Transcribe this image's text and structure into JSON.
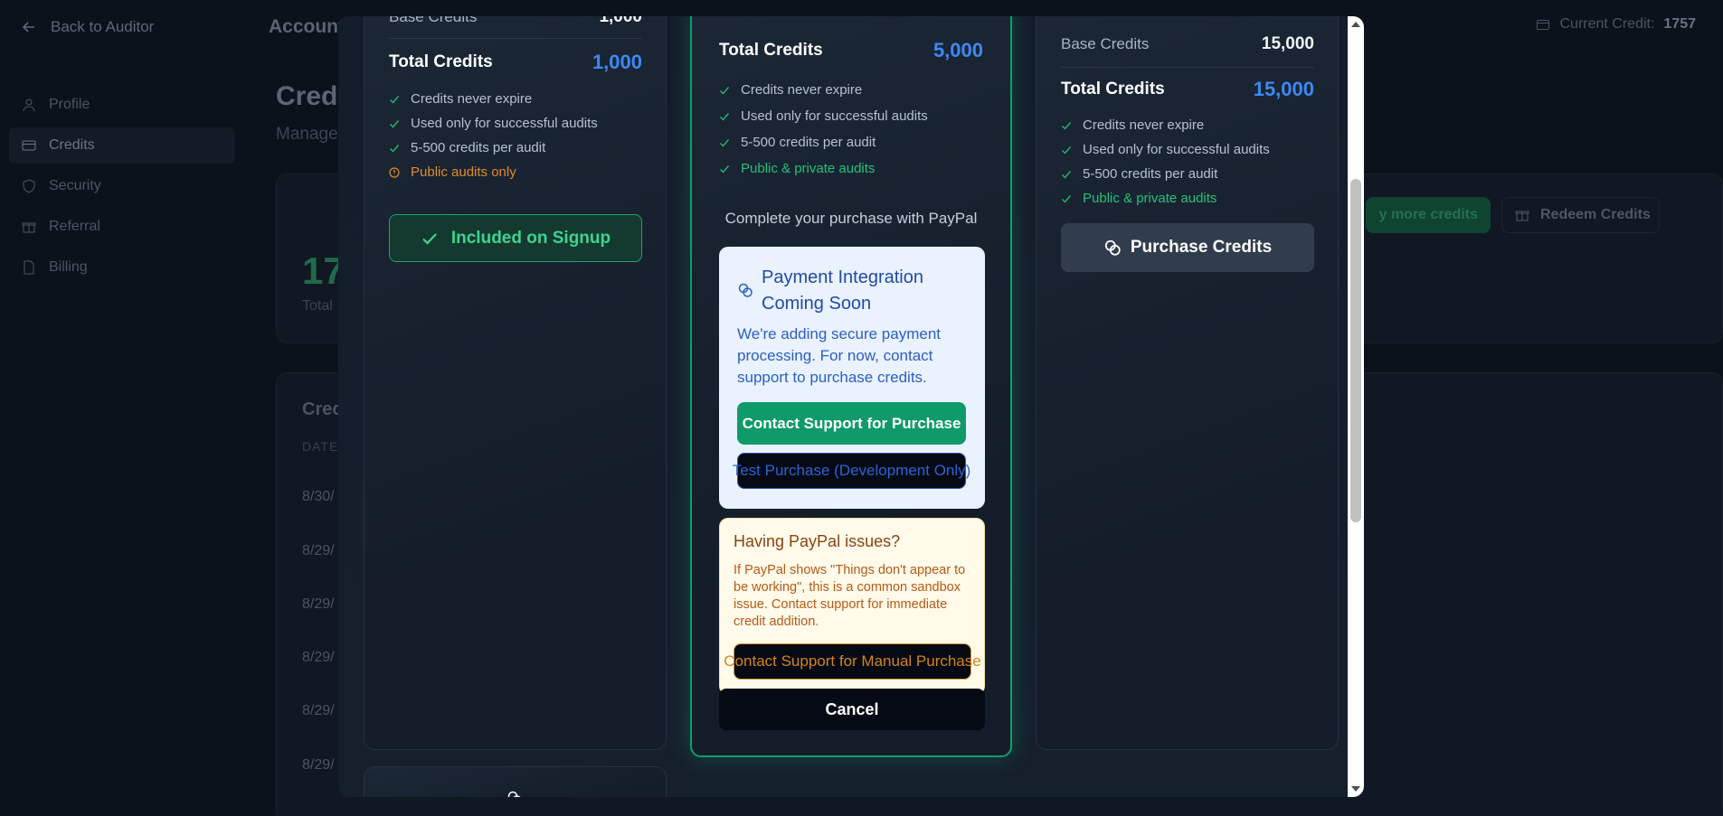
{
  "background": {
    "back_label": "Back to Auditor",
    "heading": "Account",
    "current_credit_label": "Current Credit:",
    "current_credit_value": "1757",
    "nav": [
      "Profile",
      "Credits",
      "Security",
      "Referral",
      "Billing"
    ],
    "main_title": "Credi",
    "main_subtitle": "Manage",
    "big_number": "17",
    "big_caption": "Total",
    "section_title": "Cred",
    "column_header": "DATE",
    "dates": [
      "8/30/",
      "8/29/",
      "8/29/",
      "8/29/",
      "8/29/",
      "8/29/"
    ],
    "buy_more_label": "y more credits",
    "redeem_label": "Redeem Credits"
  },
  "modal": {
    "left_plan": {
      "base_label": "Base Credits",
      "base_value": "1,000",
      "total_label": "Total Credits",
      "total_value": "1,000",
      "features": [
        "Credits never expire",
        "Used only for successful audits",
        "5-500 credits per audit",
        "Public audits only"
      ],
      "button_label": "Included on Signup"
    },
    "middle_plan": {
      "total_label": "Total Credits",
      "total_value": "5,000",
      "features": [
        "Credits never expire",
        "Used only for successful audits",
        "5-500 credits per audit",
        "Public & private audits"
      ],
      "paypal_caption": "Complete your purchase with PayPal",
      "integration_title": "Payment Integration Coming Soon",
      "integration_desc": "We're adding secure payment processing. For now, contact support to purchase credits.",
      "contact_button": "Contact Support for Purchase",
      "test_button": "Test Purchase (Development Only)",
      "issues_title": "Having PayPal issues?",
      "issues_desc": "If PayPal shows \"Things don't appear to be working\", this is a common sandbox issue. Contact support for immediate credit addition.",
      "manual_button": "Contact Support for Manual Purchase",
      "cancel_button": "Cancel"
    },
    "right_plan": {
      "base_label": "Base Credits",
      "base_value": "15,000",
      "total_label": "Total Credits",
      "total_value": "15,000",
      "features": [
        "Credits never expire",
        "Used only for successful audits",
        "5-500 credits per audit",
        "Public & private audits"
      ],
      "button_label": "Purchase Credits"
    }
  },
  "colors": {
    "accent_blue": "#3e89f3",
    "accent_green": "#0f9a69",
    "warning_orange": "#e08c2a"
  }
}
